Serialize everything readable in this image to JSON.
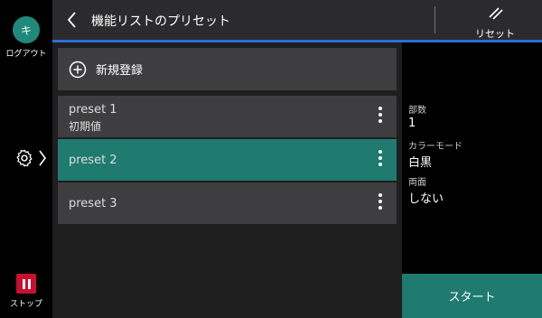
{
  "rail": {
    "logout_glyph": "キ",
    "logout_label": "ログアウト",
    "settings_icon": "gear-icon",
    "stop_label": "ストップ"
  },
  "header": {
    "title": "機能リストのプリセット",
    "reset_label": "リセット"
  },
  "main": {
    "new_registration": "新規登録",
    "presets": [
      {
        "name": "preset 1",
        "sub": "初期値",
        "selected": false
      },
      {
        "name": "preset 2",
        "sub": "",
        "selected": true
      },
      {
        "name": "preset 3",
        "sub": "",
        "selected": false
      }
    ]
  },
  "summary": {
    "copies_label": "部数",
    "copies_value": "1",
    "color_label": "カラーモード",
    "color_value": "白黒",
    "duplex_label": "両面",
    "duplex_value": "しない"
  },
  "start_label": "スタート",
  "colors": {
    "accent_teal": "#1f7a6f",
    "header_accent": "#2b6fd6",
    "stop_red": "#c8102e"
  }
}
